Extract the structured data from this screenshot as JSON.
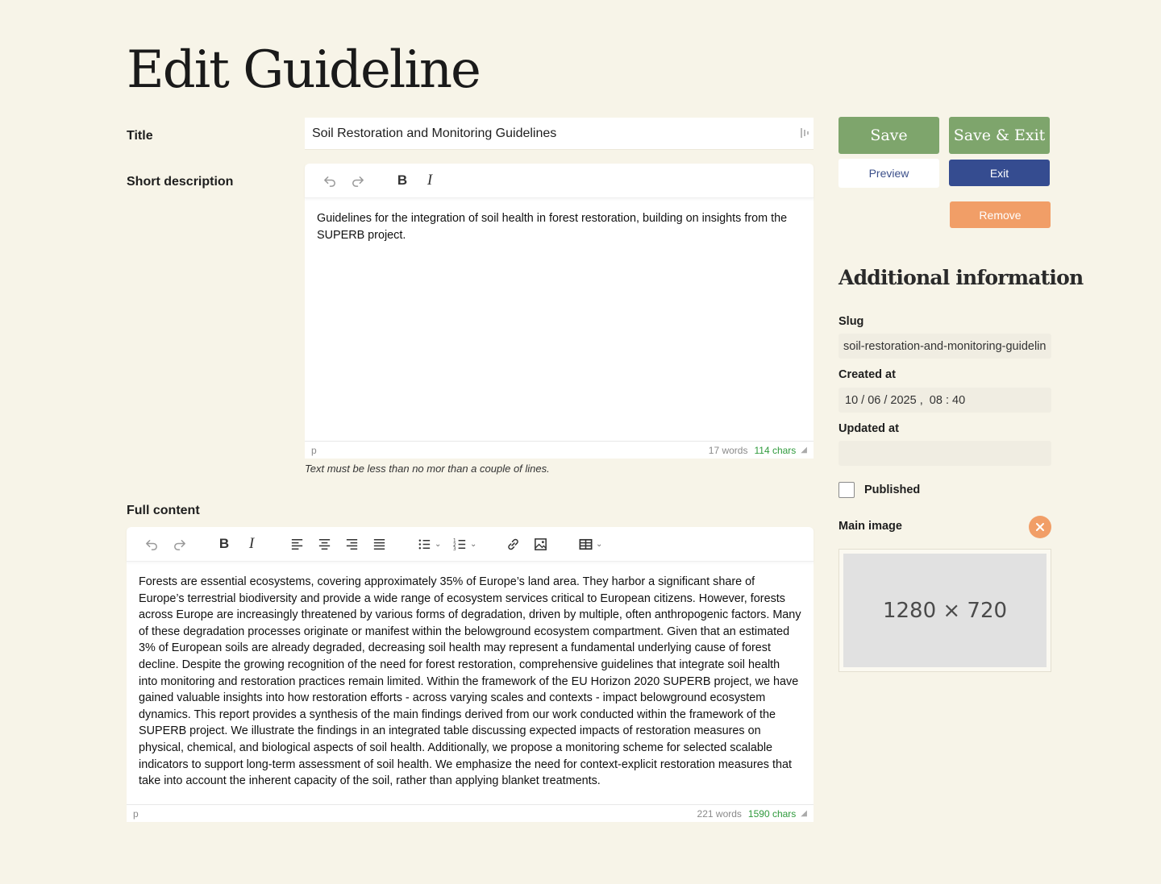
{
  "page": {
    "title": "Edit Guideline"
  },
  "fields": {
    "title_label": "Title",
    "title_value": "Soil Restoration and Monitoring Guidelines",
    "short_label": "Short description",
    "full_label": "Full content"
  },
  "short_editor": {
    "content": "Guidelines for the integration of soil health in forest restoration, building on insights from the SUPERB project.",
    "path": "p",
    "words": "17 words",
    "chars": "114 chars",
    "hint": "Text must be less than no mor than a couple of lines."
  },
  "full_editor": {
    "content": "Forests are essential ecosystems, covering approximately 35% of Europe’s land area. They harbor a significant share of Europe’s terrestrial biodiversity and provide a wide range of ecosystem services critical to European citizens. However, forests across Europe are increasingly threatened by various forms of degradation, driven by multiple, often anthropogenic factors. Many of these degradation processes originate or manifest within the belowground ecosystem compartment. Given that an estimated 3% of European soils are already degraded, decreasing soil health may represent a fundamental underlying cause of forest decline. Despite the growing recognition of the need for forest restoration, comprehensive guidelines that integrate soil health into monitoring and restoration practices remain limited. Within the framework of the EU Horizon 2020 SUPERB project, we have gained valuable insights into how restoration efforts - across varying scales and contexts - impact belowground ecosystem dynamics. This report provides a synthesis of the main findings derived from our work conducted within the framework of the SUPERB project. We illustrate the findings in an integrated table discussing expected impacts of restoration measures on physical, chemical, and biological aspects of soil health. Additionally, we propose a monitoring scheme for selected scalable indicators to support long-term assessment of soil health. We emphasize the need for context-explicit restoration measures that take into account the inherent capacity of the soil, rather than applying blanket treatments.",
    "path": "p",
    "words": "221 words",
    "chars": "1590 chars"
  },
  "actions": {
    "save": "Save",
    "save_exit": "Save & Exit",
    "preview": "Preview",
    "exit": "Exit",
    "remove": "Remove"
  },
  "additional": {
    "title": "Additional information",
    "slug_label": "Slug",
    "slug_value": "soil-restoration-and-monitoring-guidelines",
    "created_label": "Created at",
    "created_value": "10 / 06 / 2025 ,  08 : 40",
    "updated_label": "Updated at",
    "updated_value": "",
    "published_label": "Published",
    "main_image_label": "Main image",
    "image_placeholder": "1280 × 720"
  },
  "colors": {
    "background": "#f7f4e8",
    "save": "#7ea56c",
    "exit": "#354c90",
    "remove": "#f19e67",
    "chars_ok": "#2f9a3c"
  }
}
